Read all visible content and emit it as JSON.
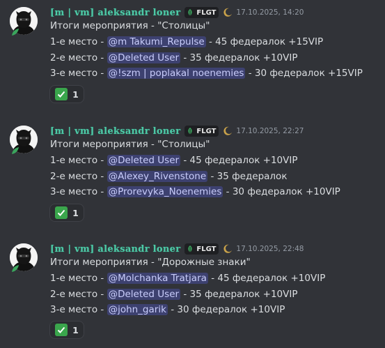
{
  "colors": {
    "background": "#313338",
    "username": "#4ec9a6",
    "mention_bg": "#4a5190",
    "reaction_bg": "#2b2d31",
    "check": "#3aa64c"
  },
  "messages": [
    {
      "username": "[m | vm] aleksandr loner",
      "tag": "FLGT",
      "timestamp": "17.10.2025, 14:20",
      "title": "Итоги мероприятия - \"Столицы\"",
      "places": [
        {
          "prefix": "1-е место - ",
          "mention": "@m Takumi_Repulse",
          "reward": " - 45 федералок +15VIP"
        },
        {
          "prefix": "2-е место - ",
          "mention": "@Deleted User",
          "reward": " - 35 федералок +10VIP"
        },
        {
          "prefix": "3-е место - ",
          "mention": "@!szm | poplakal noenemies",
          "reward": " - 30 федералок +15VIP"
        }
      ],
      "reaction": {
        "emoji": "check-mark-icon",
        "count": "1"
      }
    },
    {
      "username": "[m | vm] aleksandr loner",
      "tag": "FLGT",
      "timestamp": "17.10.2025, 22:27",
      "title": "Итоги мероприятия - \"Столицы\"",
      "places": [
        {
          "prefix": "1-е место - ",
          "mention": "@Deleted User",
          "reward": " - 45 федералок +10VIP"
        },
        {
          "prefix": "2-е место - ",
          "mention": "@Alexey_Rivenstone",
          "reward": " - 35 федералок"
        },
        {
          "prefix": "3-е место - ",
          "mention": "@Prorevyka_Noenemies",
          "reward": " - 30 федералок +10VIP"
        }
      ],
      "reaction": {
        "emoji": "check-mark-icon",
        "count": "1"
      }
    },
    {
      "username": "[m | vm] aleksandr loner",
      "tag": "FLGT",
      "timestamp": "17.10.2025, 22:48",
      "title": "Итоги мероприятия - \"Дорожные знаки\"",
      "places": [
        {
          "prefix": "1-е место - ",
          "mention": "@Molchanka Tratjara",
          "reward": " - 45 федералок +10VIP"
        },
        {
          "prefix": "2-е место - ",
          "mention": "@Deleted User",
          "reward": " - 35 федералок +10VIP"
        },
        {
          "prefix": "3-е место - ",
          "mention": "@john_garik",
          "reward": " - 30 федералок +10VIP"
        }
      ],
      "reaction": {
        "emoji": "check-mark-icon",
        "count": "1"
      }
    }
  ]
}
